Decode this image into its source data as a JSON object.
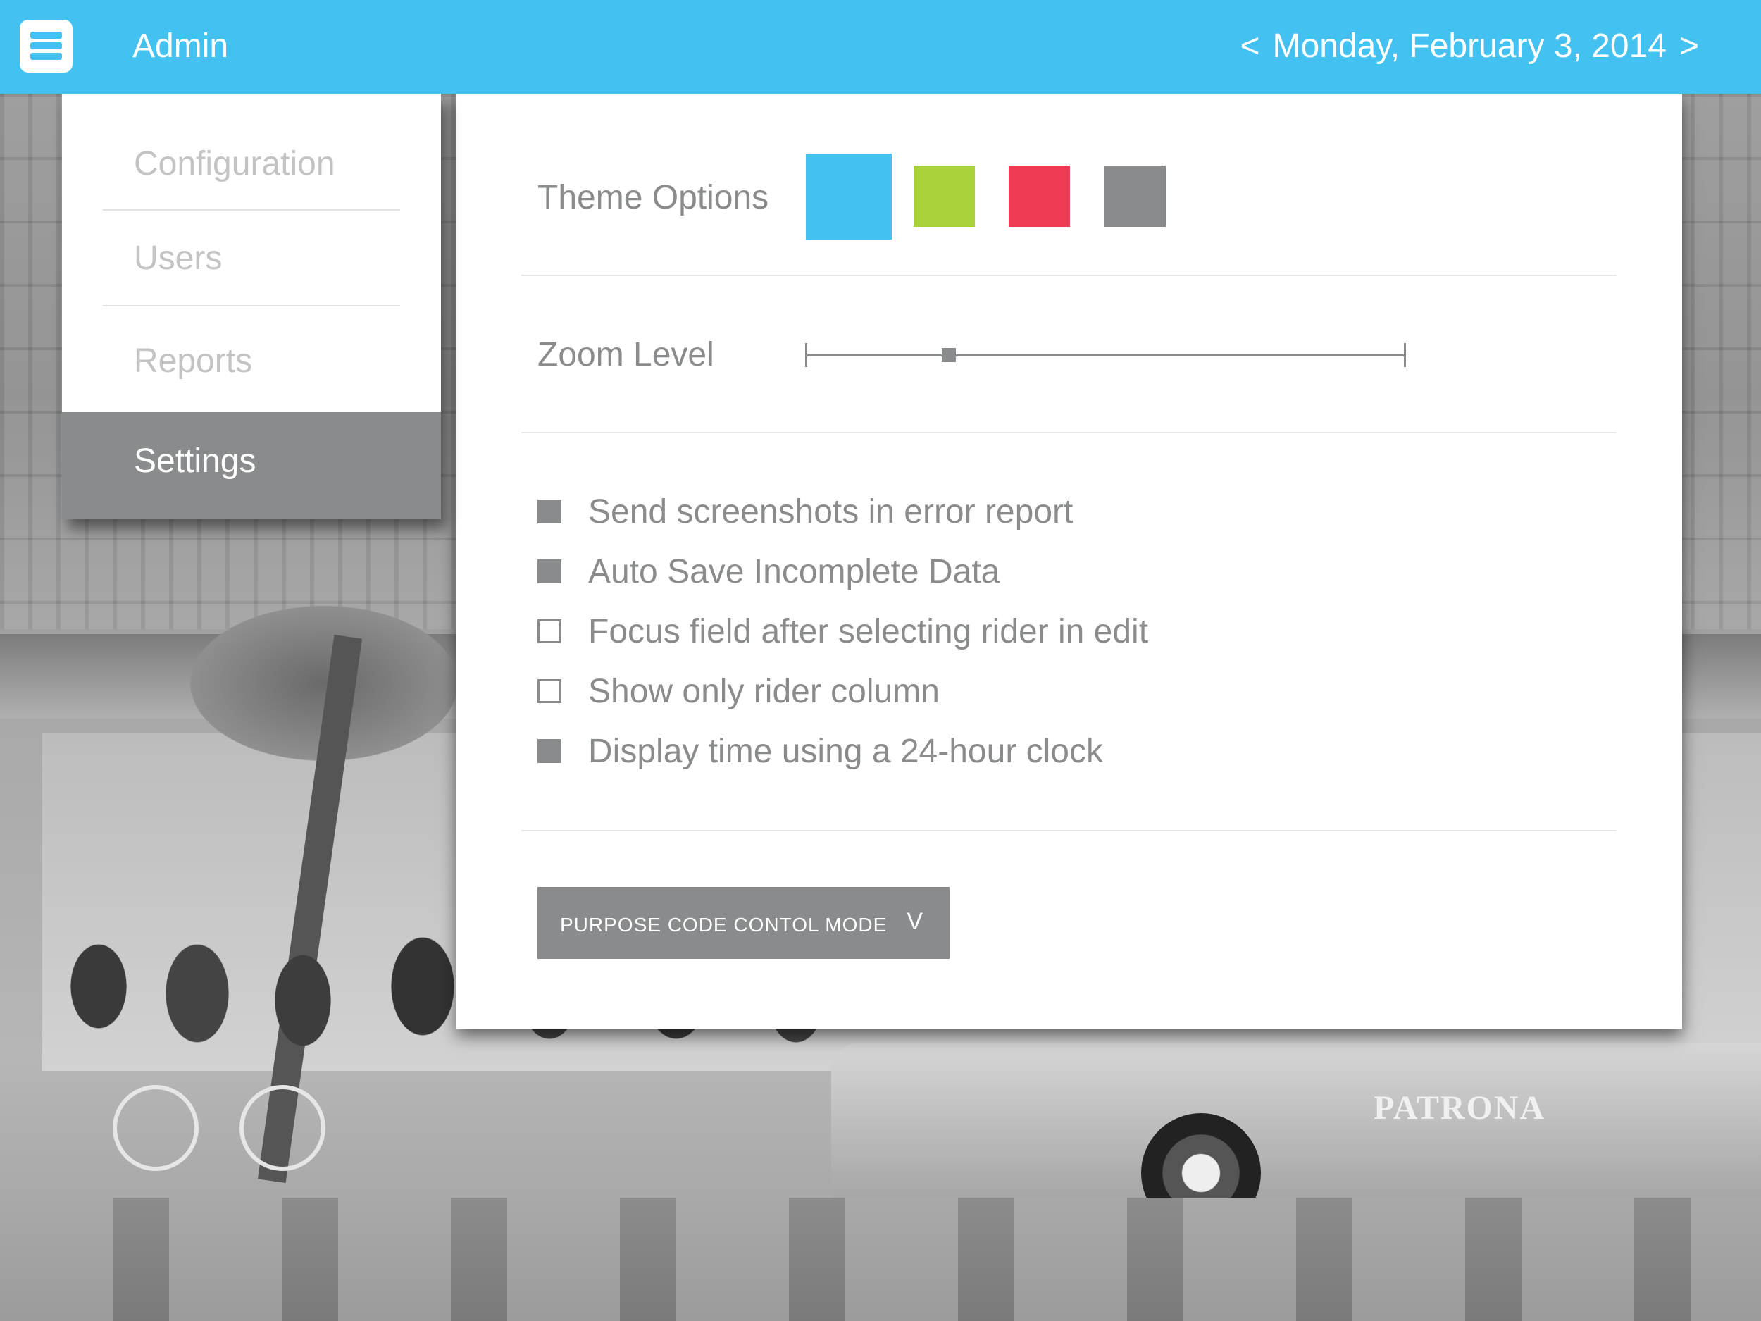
{
  "header": {
    "title": "Admin",
    "date_prev": "<",
    "date": "Monday, February 3, 2014",
    "date_next": ">",
    "accent_color": "#43c1f0"
  },
  "sidebar": {
    "items": [
      {
        "label": "Configuration",
        "active": false
      },
      {
        "label": "Users",
        "active": false
      },
      {
        "label": "Reports",
        "active": false
      },
      {
        "label": "Settings",
        "active": true
      }
    ]
  },
  "settings": {
    "theme": {
      "label": "Theme Options",
      "swatches": [
        {
          "name": "blue",
          "color": "#43c1f0",
          "selected": true
        },
        {
          "name": "green",
          "color": "#a8d13a",
          "selected": false
        },
        {
          "name": "red",
          "color": "#ee3a52",
          "selected": false
        },
        {
          "name": "gray",
          "color": "#8a8b8d",
          "selected": false
        }
      ]
    },
    "zoom": {
      "label": "Zoom Level",
      "value_fraction": 0.24
    },
    "options": [
      {
        "label": "Send screenshots in error report",
        "checked": true
      },
      {
        "label": "Auto Save Incomplete Data",
        "checked": true
      },
      {
        "label": "Focus field after selecting rider in edit",
        "checked": false
      },
      {
        "label": "Show only rider column",
        "checked": false
      },
      {
        "label": "Display time using a 24-hour clock",
        "checked": true
      }
    ],
    "dropdown": {
      "label": "PURPOSE CODE CONTOL MODE",
      "chevron": "V"
    }
  },
  "background": {
    "bus_ad_text": "PATRONA"
  }
}
